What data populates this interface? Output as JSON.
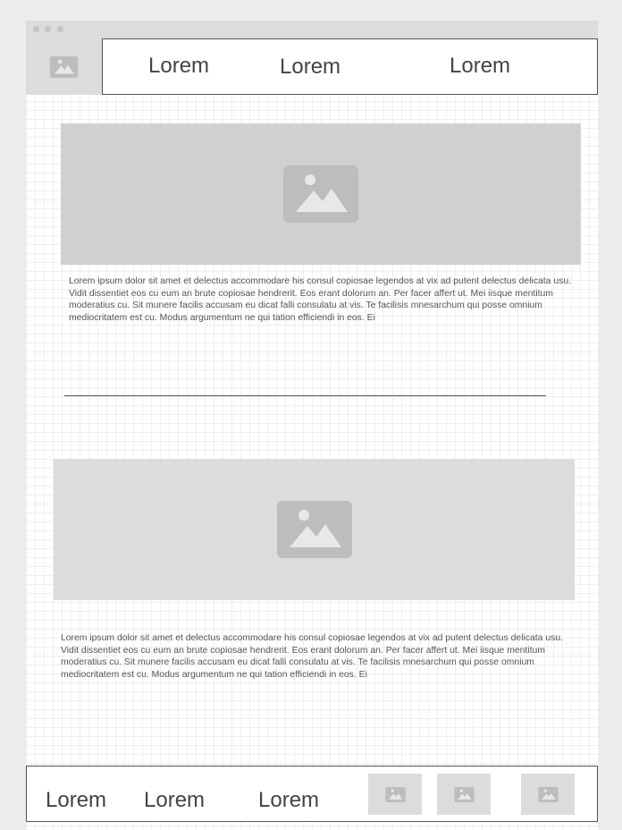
{
  "window": {
    "title_dots": [
      "dot",
      "dot",
      "dot"
    ]
  },
  "header": {
    "logo_icon": "image-placeholder-icon",
    "nav": [
      {
        "label": "Lorem"
      },
      {
        "label": "Lorem"
      },
      {
        "label": "Lorem"
      }
    ]
  },
  "main": {
    "sections": [
      {
        "image_icon": "image-placeholder-icon",
        "text": "Lorem ipsum dolor sit amet et delectus accommodare his consul copiosae legendos at vix ad putent delectus delicata usu. Vidit dissentiet eos cu eum an brute copiosae hendrerit. Eos erant dolorum an. Per facer affert ut. Mei iisque mentitum moderatius cu. Sit munere facilis accusam eu dicat falli consulatu at vis. Te facilisis mnesarchum qui posse omnium mediocritatem est cu. Modus argumentum ne qui tation efficiendi in eos. Ei"
      },
      {
        "image_icon": "image-placeholder-icon",
        "text": "Lorem ipsum dolor sit amet et delectus accommodare his consul copiosae legendos at vix ad putent delectus delicata usu. Vidit dissentiet eos cu eum an brute copiosae hendrerit. Eos erant dolorum an. Per facer affert ut. Mei iisque mentitum moderatius cu. Sit munere facilis accusam eu dicat falli consulatu at vis. Te facilisis mnesarchum qui posse omnium mediocritatem est cu. Modus argumentum ne qui tation efficiendi in eos. Ei"
      }
    ]
  },
  "footer": {
    "links": [
      {
        "label": "Lorem"
      },
      {
        "label": "Lorem"
      },
      {
        "label": "Lorem"
      }
    ],
    "thumbnails": [
      "image-placeholder-icon",
      "image-placeholder-icon",
      "image-placeholder-icon"
    ]
  },
  "colors": {
    "placeholder_fill": "#d0d0d0",
    "placeholder_fill_light": "#dcdcdc",
    "icon_fill": "#bdbdbd",
    "border": "#555555",
    "text": "#444444"
  }
}
